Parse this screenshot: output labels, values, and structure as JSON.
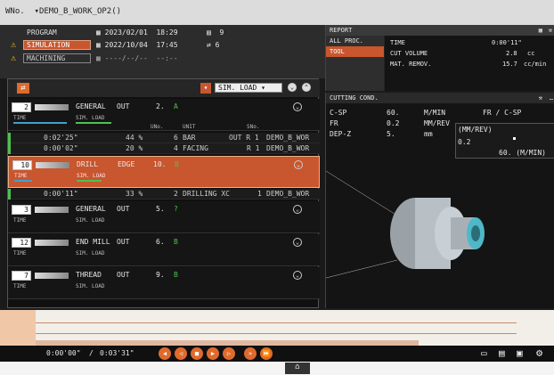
{
  "header": {
    "wno_label": "WNo.",
    "wno_value": "DEMO_B_WORK_OP2()"
  },
  "program": {
    "label": "PROGRAM",
    "modes": [
      {
        "label": "SIMULATION",
        "warn": "⚠",
        "date": "2022/10/04",
        "time": "17:45",
        "count": "6"
      },
      {
        "label": "MACHINING",
        "warn": "⚠",
        "date": "----/--/--",
        "time": "--:--",
        "count": ""
      }
    ],
    "top_date": "2023/02/01",
    "top_time": "18:29",
    "top_count": "9"
  },
  "report": {
    "title": "REPORT",
    "tabs": [
      "ALL PROC.",
      "TOOL"
    ],
    "rows": [
      {
        "label": "TIME",
        "value": "0:00'11\"",
        "unit": ""
      },
      {
        "label": "CUT VOLUME",
        "value": "2.8",
        "unit": "cc"
      },
      {
        "label": "MAT. REMOV.",
        "value": "15.7",
        "unit": "cc/min"
      }
    ]
  },
  "list": {
    "mode_select": "SIM. LOAD",
    "items": [
      {
        "num": "2",
        "name": "GENERAL",
        "sub": "OUT",
        "seq": "2.",
        "code": "A",
        "time_lbl": "TIME",
        "sim_lbl": "SIM. LOAD",
        "cols": [
          "UNo.",
          "UNIT",
          "SNo."
        ]
      },
      {
        "num": "10",
        "name": "DRILL",
        "sub": "EDGE",
        "seq": "10.",
        "code": "B",
        "time_lbl": "TIME",
        "sim_lbl": "SIM. LOAD",
        "selected": true
      },
      {
        "num": "3",
        "name": "GENERAL",
        "sub": "OUT",
        "seq": "5.",
        "code": "?",
        "time_lbl": "TIME",
        "sim_lbl": "SIM. LOAD"
      },
      {
        "num": "12",
        "name": "END MILL",
        "sub": "OUT",
        "seq": "6.",
        "code": "B",
        "time_lbl": "TIME",
        "sim_lbl": "SIM. LOAD"
      },
      {
        "num": "7",
        "name": "THREAD",
        "sub": "OUT",
        "seq": "9.",
        "code": "B",
        "time_lbl": "TIME",
        "sim_lbl": "SIM. LOAD"
      }
    ],
    "subrows": [
      {
        "time": "0:02'25\"",
        "load": "44 %",
        "uno": "6",
        "unit": "BAR",
        "extra": "OUT R 1",
        "work": "DEMO_B_WOR"
      },
      {
        "time": "0:00'02\"",
        "load": "20 %",
        "uno": "4",
        "unit": "FACING",
        "extra": "R 1",
        "work": "DEMO_B_WOR"
      },
      {
        "time": "0:00'11\"",
        "load": "33 %",
        "uno": "2",
        "unit": "DRILLING XC",
        "extra": "1",
        "work": "DEMO_B_WOR"
      }
    ]
  },
  "cutting": {
    "title": "CUTTING COND.",
    "rows": [
      {
        "label": "C-SP",
        "value": "60.",
        "unit": "M/MIN"
      },
      {
        "label": "FR",
        "value": "0.2",
        "unit": "MM/REV"
      },
      {
        "label": "DEP-Z",
        "value": "5.",
        "unit": "mm"
      }
    ],
    "graph_title": "FR / C-SP",
    "graph_y": "(MM/REV)",
    "graph_yval": "0.2",
    "graph_x": "60. (M/MIN)"
  },
  "status": {
    "elapsed": "0:00'00\"",
    "total": "0:03'31\"",
    "separator": "/"
  },
  "colors": {
    "accent": "#c8562e",
    "panel": "#151515"
  }
}
